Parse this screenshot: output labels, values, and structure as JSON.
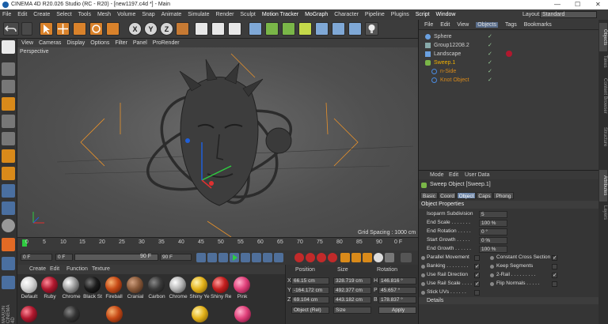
{
  "window": {
    "title": "CINEMA 4D R20.026 Studio (RC - R20) - [new1197.c4d *] - Main",
    "minimize": "—",
    "maximize": "☐",
    "close": "✕"
  },
  "menubar": {
    "items": [
      "File",
      "Edit",
      "Create",
      "Select",
      "Tools",
      "Mesh",
      "Volume",
      "Snap",
      "Animate",
      "Simulate",
      "Render",
      "Sculpt",
      "Motion Tracker",
      "MoGraph",
      "Character",
      "Pipeline",
      "Plugins",
      "Script",
      "Window"
    ],
    "layout_label": "Layout:",
    "layout_value": "Standard"
  },
  "toolbar": {
    "axis_x": "X",
    "axis_y": "Y",
    "axis_z": "Z"
  },
  "viewport": {
    "menu": [
      "View",
      "Cameras",
      "Display",
      "Options",
      "Filter",
      "Panel",
      "ProRender"
    ],
    "camera_label": "Perspective",
    "grid_spacing": "Grid Spacing : 1000 cm"
  },
  "timeline": {
    "ticks": [
      "0",
      "5",
      "10",
      "15",
      "20",
      "25",
      "30",
      "35",
      "40",
      "45",
      "50",
      "55",
      "60",
      "65",
      "70",
      "75",
      "80",
      "85",
      "90"
    ],
    "end_marker": "0 F",
    "current_frame": "0 F",
    "start_frame": "0 F",
    "range_end": "90 F",
    "end_frame": "90 F"
  },
  "materials": {
    "menu": [
      "Create",
      "Edit",
      "Function",
      "Texture"
    ],
    "items": [
      {
        "name": "Default",
        "color": "#d8d8d8"
      },
      {
        "name": "Ruby",
        "color": "#b0182e"
      },
      {
        "name": "Chrome",
        "color": "#9a9a9a"
      },
      {
        "name": "Black St",
        "color": "#1c1c1c"
      },
      {
        "name": "Fireball",
        "color": "#c74a16"
      },
      {
        "name": "Cranial",
        "color": "#8a5a3a"
      },
      {
        "name": "Carbon",
        "color": "#3a3a3a"
      },
      {
        "name": "Chrome",
        "color": "#b5b5b5"
      },
      {
        "name": "Shiny Ye",
        "color": "#e3b21a"
      },
      {
        "name": "Shiny Re",
        "color": "#c41f1f"
      },
      {
        "name": "Pink",
        "color": "#e0407a"
      }
    ]
  },
  "coordinates": {
    "headers": [
      "Position",
      "Size",
      "Rotation"
    ],
    "rows": [
      {
        "axis": "X",
        "pos": "66.15 cm",
        "size": "328.719 cm",
        "rot_axis": "H",
        "rot": "146.816 °"
      },
      {
        "axis": "Y",
        "pos": "-164.172 cm",
        "size": "492.377 cm",
        "rot_axis": "P",
        "rot": "45.657 °"
      },
      {
        "axis": "Z",
        "pos": "69.104 cm",
        "size": "443.182 cm",
        "rot_axis": "B",
        "rot": "178.837 °"
      }
    ],
    "mode": "Object (Rel)",
    "size_mode": "Size",
    "apply": "Apply"
  },
  "object_manager": {
    "menu": [
      "File",
      "Edit",
      "View",
      "Objects",
      "Tags",
      "Bookmarks"
    ],
    "objects": [
      {
        "name": "Sphere",
        "indent": 0,
        "color": "#cfcfcf"
      },
      {
        "name": "Group12208.2",
        "indent": 0,
        "color": "#cfcfcf"
      },
      {
        "name": "Landscape",
        "indent": 0,
        "color": "#cfcfcf"
      },
      {
        "name": "Sweep.1",
        "indent": 0,
        "color": "#f0b000"
      },
      {
        "name": "n-Side",
        "indent": 1,
        "color": "#d98a1a"
      },
      {
        "name": "Knot Object",
        "indent": 1,
        "color": "#d98a1a"
      }
    ]
  },
  "attribute_manager": {
    "menu": [
      "Mode",
      "Edit",
      "User Data"
    ],
    "object_title": "Sweep Object [Sweep.1]",
    "tabs": [
      "Basic",
      "Coord",
      "Object",
      "Caps",
      "Phong"
    ],
    "active_tab": "Object",
    "section": "Object Properties",
    "fields": [
      {
        "label": "Isoparm Subdivision",
        "value": "5"
      },
      {
        "label": "End Scale . . . . . . .",
        "value": "100 %"
      },
      {
        "label": "End Rotation . . . . .",
        "value": "0 °"
      },
      {
        "label": "Start Growth . . . . .",
        "value": "0 %"
      },
      {
        "label": "End Growth . . . . . .",
        "value": "100 %"
      }
    ],
    "checks_left": [
      {
        "label": "Parallel Movement",
        "checked": false
      },
      {
        "label": "Banking . . . . . . . .",
        "checked": true
      },
      {
        "label": "Use Rail Direction",
        "checked": true
      },
      {
        "label": "Use Rail Scale . . . .",
        "checked": true
      },
      {
        "label": "Stick UVs . . . . . .",
        "checked": false
      }
    ],
    "checks_right": [
      {
        "label": "Constant Cross Section",
        "checked": true
      },
      {
        "label": "Keep Segments",
        "checked": false
      },
      {
        "label": "2-Rail . . . . . . . . .",
        "checked": true
      },
      {
        "label": "Flip Normals . . . . .",
        "checked": false
      }
    ],
    "details": "Details"
  },
  "side_tabs": [
    "Objects",
    "Takes",
    "Content Browser",
    "Structure",
    "Attributes",
    "Layers"
  ]
}
